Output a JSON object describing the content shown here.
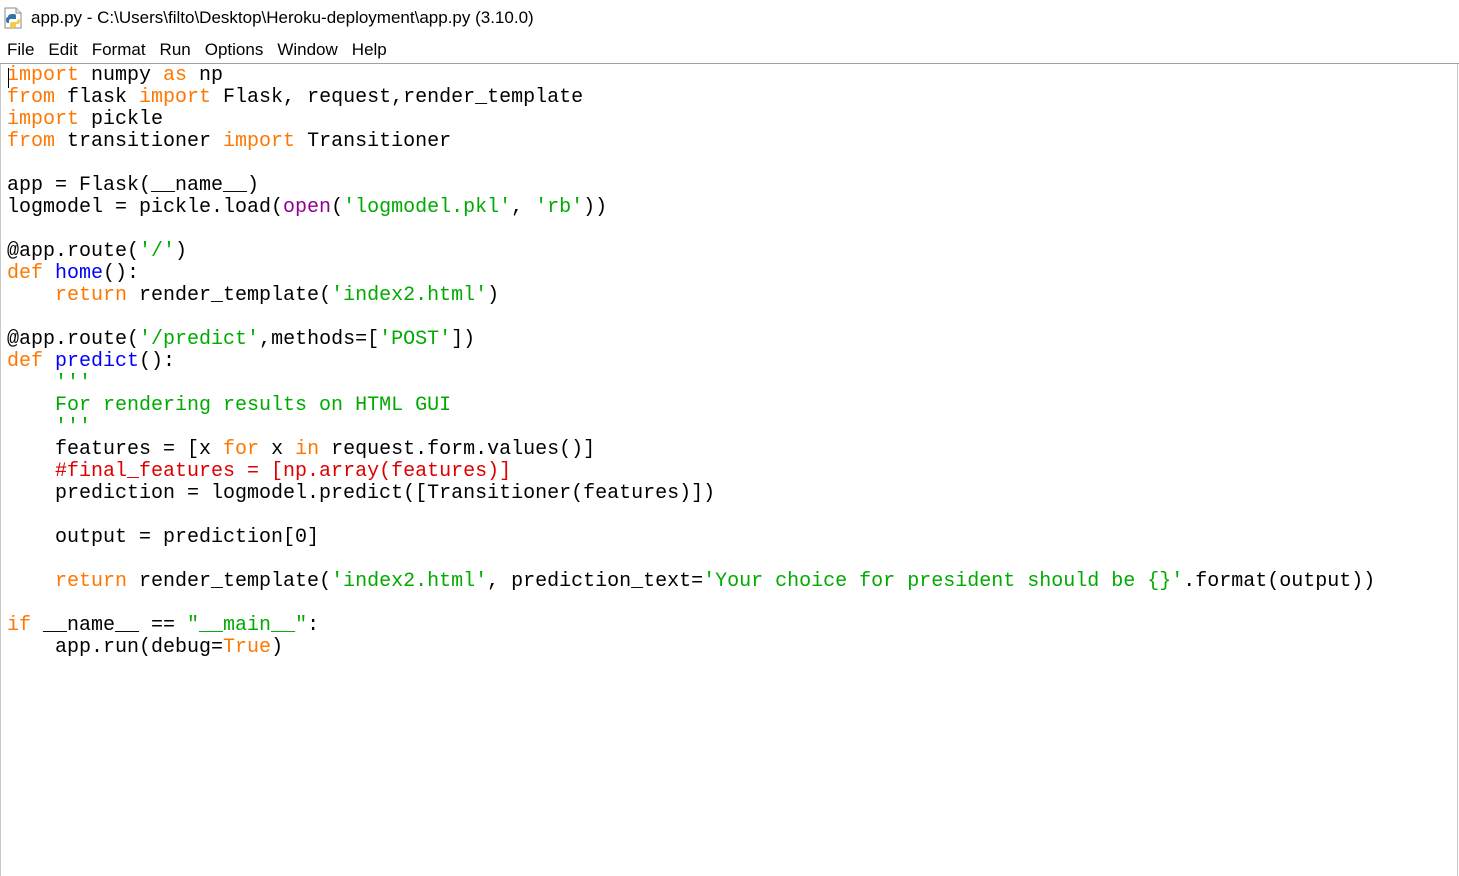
{
  "window": {
    "title": "app.py - C:\\Users\\filto\\Desktop\\Heroku-deployment\\app.py (3.10.0)",
    "icon": "python-file-icon"
  },
  "menu": [
    "File",
    "Edit",
    "Format",
    "Run",
    "Options",
    "Window",
    "Help"
  ],
  "colors": {
    "keyword": "#ff7700",
    "builtin": "#900090",
    "string": "#00aa00",
    "comment": "#dd0000",
    "definition": "#0000ff",
    "default": "#000000"
  },
  "code_lines": [
    [
      {
        "t": "import",
        "c": "kw"
      },
      {
        "t": " numpy "
      },
      {
        "t": "as",
        "c": "kw"
      },
      {
        "t": " np"
      }
    ],
    [
      {
        "t": "from",
        "c": "kw"
      },
      {
        "t": " flask "
      },
      {
        "t": "import",
        "c": "kw"
      },
      {
        "t": " Flask, request,render_template"
      }
    ],
    [
      {
        "t": "import",
        "c": "kw"
      },
      {
        "t": " pickle"
      }
    ],
    [
      {
        "t": "from",
        "c": "kw"
      },
      {
        "t": " transitioner "
      },
      {
        "t": "import",
        "c": "kw"
      },
      {
        "t": " Transitioner"
      }
    ],
    [],
    [
      {
        "t": "app = Flask(__name__)"
      }
    ],
    [
      {
        "t": "logmodel = pickle.load("
      },
      {
        "t": "open",
        "c": "bi"
      },
      {
        "t": "("
      },
      {
        "t": "'logmodel.pkl'",
        "c": "str"
      },
      {
        "t": ", "
      },
      {
        "t": "'rb'",
        "c": "str"
      },
      {
        "t": "))"
      }
    ],
    [],
    [
      {
        "t": "@app.route("
      },
      {
        "t": "'/'",
        "c": "str"
      },
      {
        "t": ")"
      }
    ],
    [
      {
        "t": "def",
        "c": "kw"
      },
      {
        "t": " "
      },
      {
        "t": "home",
        "c": "df"
      },
      {
        "t": "():"
      }
    ],
    [
      {
        "t": "    "
      },
      {
        "t": "return",
        "c": "kw"
      },
      {
        "t": " render_template("
      },
      {
        "t": "'index2.html'",
        "c": "str"
      },
      {
        "t": ")"
      }
    ],
    [],
    [
      {
        "t": "@app.route("
      },
      {
        "t": "'/predict'",
        "c": "str"
      },
      {
        "t": ",methods=["
      },
      {
        "t": "'POST'",
        "c": "str"
      },
      {
        "t": "])"
      }
    ],
    [
      {
        "t": "def",
        "c": "kw"
      },
      {
        "t": " "
      },
      {
        "t": "predict",
        "c": "df"
      },
      {
        "t": "():"
      }
    ],
    [
      {
        "t": "    "
      },
      {
        "t": "'''",
        "c": "str"
      }
    ],
    [
      {
        "t": "    "
      },
      {
        "t": "For rendering results on HTML GUI",
        "c": "str"
      }
    ],
    [
      {
        "t": "    "
      },
      {
        "t": "'''",
        "c": "str"
      }
    ],
    [
      {
        "t": "    features = [x "
      },
      {
        "t": "for",
        "c": "kw"
      },
      {
        "t": " x "
      },
      {
        "t": "in",
        "c": "kw"
      },
      {
        "t": " request.form.values()]"
      }
    ],
    [
      {
        "t": "    "
      },
      {
        "t": "#final_features = [np.array(features)]",
        "c": "cm"
      }
    ],
    [
      {
        "t": "    prediction = logmodel.predict([Transitioner(features)])"
      }
    ],
    [],
    [
      {
        "t": "    output = prediction[0]"
      }
    ],
    [],
    [
      {
        "t": "    "
      },
      {
        "t": "return",
        "c": "kw"
      },
      {
        "t": " render_template("
      },
      {
        "t": "'index2.html'",
        "c": "str"
      },
      {
        "t": ", prediction_text="
      },
      {
        "t": "'Your choice for president should be {}'",
        "c": "str"
      },
      {
        "t": ".format(output))"
      }
    ],
    [],
    [
      {
        "t": "if",
        "c": "kw"
      },
      {
        "t": " __name__ == "
      },
      {
        "t": "\"__main__\"",
        "c": "str"
      },
      {
        "t": ":"
      }
    ],
    [
      {
        "t": "    app.run(debug="
      },
      {
        "t": "True",
        "c": "kw"
      },
      {
        "t": ")"
      }
    ]
  ]
}
